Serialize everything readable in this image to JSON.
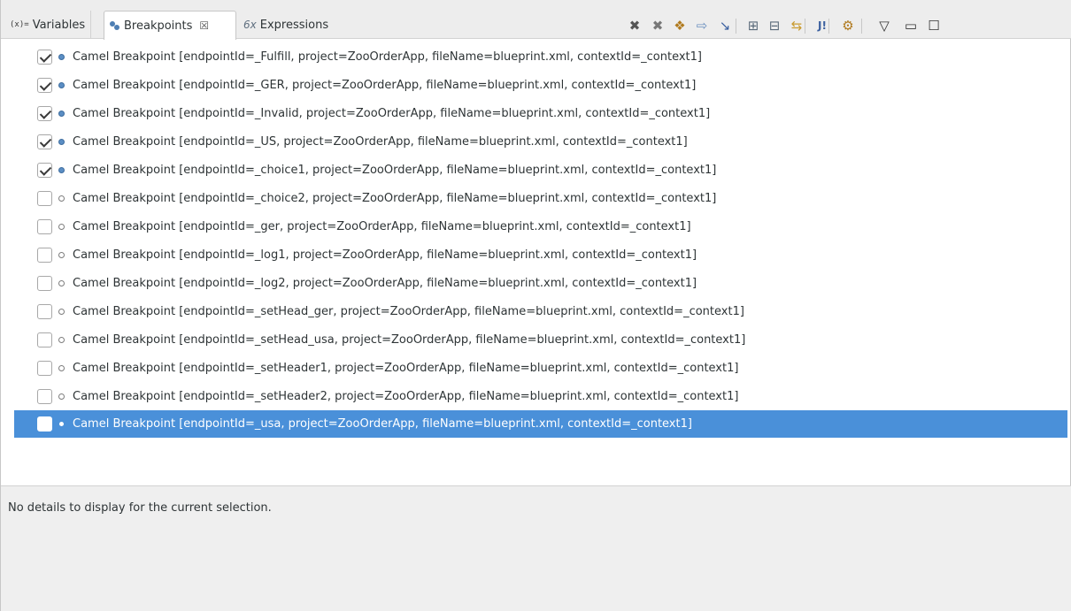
{
  "tabs": [
    {
      "label": "Variables",
      "icon": "(x)="
    },
    {
      "label": "Breakpoints",
      "close": "☒"
    },
    {
      "label": "Expressions",
      "icon": "6x"
    }
  ],
  "toolbar": [
    {
      "name": "remove-breakpoint-icon",
      "glyph": "✖",
      "color": "#555555"
    },
    {
      "name": "remove-all-breakpoints-icon",
      "glyph": "✖",
      "color": "#777777"
    },
    {
      "name": "show-supported-breakpoints-icon",
      "glyph": "❖",
      "color": "#b07a1e"
    },
    {
      "name": "go-to-file-icon",
      "glyph": "⇨",
      "color": "#6a8fbf"
    },
    {
      "name": "skip-breakpoints-icon",
      "glyph": "↘",
      "color": "#3a5f9f"
    },
    {
      "name": "expand-all-icon",
      "glyph": "⊞",
      "color": "#5a6a7a"
    },
    {
      "name": "collapse-all-icon",
      "glyph": "⊟",
      "color": "#5a6a7a"
    },
    {
      "name": "link-with-debug-view-icon",
      "glyph": "⇆",
      "color": "#c99a2e"
    },
    {
      "name": "add-java-exception-breakpoint-icon",
      "glyph": "J!",
      "color": "#3a5f9f"
    },
    {
      "name": "toggle-tracepoint-icon",
      "glyph": "⚙",
      "color": "#b07a1e"
    },
    {
      "name": "view-menu-icon",
      "glyph": "▽",
      "color": "#333333"
    },
    {
      "name": "minimize-icon",
      "glyph": "▭",
      "color": "#333333"
    },
    {
      "name": "maximize-icon",
      "glyph": "☐",
      "color": "#333333"
    }
  ],
  "breakpoints": [
    {
      "label": "Camel Breakpoint [endpointId=_Fulfill, project=ZooOrderApp, fileName=blueprint.xml, contextId=_context1]",
      "checked": true
    },
    {
      "label": "Camel Breakpoint [endpointId=_GER, project=ZooOrderApp, fileName=blueprint.xml, contextId=_context1]",
      "checked": true
    },
    {
      "label": "Camel Breakpoint [endpointId=_Invalid, project=ZooOrderApp, fileName=blueprint.xml, contextId=_context1]",
      "checked": true
    },
    {
      "label": "Camel Breakpoint [endpointId=_US, project=ZooOrderApp, fileName=blueprint.xml, contextId=_context1]",
      "checked": true
    },
    {
      "label": "Camel Breakpoint [endpointId=_choice1, project=ZooOrderApp, fileName=blueprint.xml, contextId=_context1]",
      "checked": true
    },
    {
      "label": "Camel Breakpoint [endpointId=_choice2, project=ZooOrderApp, fileName=blueprint.xml, contextId=_context1]",
      "checked": false
    },
    {
      "label": "Camel Breakpoint [endpointId=_ger, project=ZooOrderApp, fileName=blueprint.xml, contextId=_context1]",
      "checked": false
    },
    {
      "label": "Camel Breakpoint [endpointId=_log1, project=ZooOrderApp, fileName=blueprint.xml, contextId=_context1]",
      "checked": false
    },
    {
      "label": "Camel Breakpoint [endpointId=_log2, project=ZooOrderApp, fileName=blueprint.xml, contextId=_context1]",
      "checked": false
    },
    {
      "label": "Camel Breakpoint [endpointId=_setHead_ger, project=ZooOrderApp, fileName=blueprint.xml, contextId=_context1]",
      "checked": false
    },
    {
      "label": "Camel Breakpoint [endpointId=_setHead_usa, project=ZooOrderApp, fileName=blueprint.xml, contextId=_context1]",
      "checked": false
    },
    {
      "label": "Camel Breakpoint [endpointId=_setHeader1, project=ZooOrderApp, fileName=blueprint.xml, contextId=_context1]",
      "checked": false
    },
    {
      "label": "Camel Breakpoint [endpointId=_setHeader2, project=ZooOrderApp, fileName=blueprint.xml, contextId=_context1]",
      "checked": false
    },
    {
      "label": "Camel Breakpoint [endpointId=_usa, project=ZooOrderApp, fileName=blueprint.xml, contextId=_context1]",
      "checked": false,
      "selected": true
    }
  ],
  "details": {
    "text": "No details to display for the current selection."
  },
  "colors": {
    "selection": "#4a90d9",
    "enabled_dot": "#5b8ec4"
  }
}
